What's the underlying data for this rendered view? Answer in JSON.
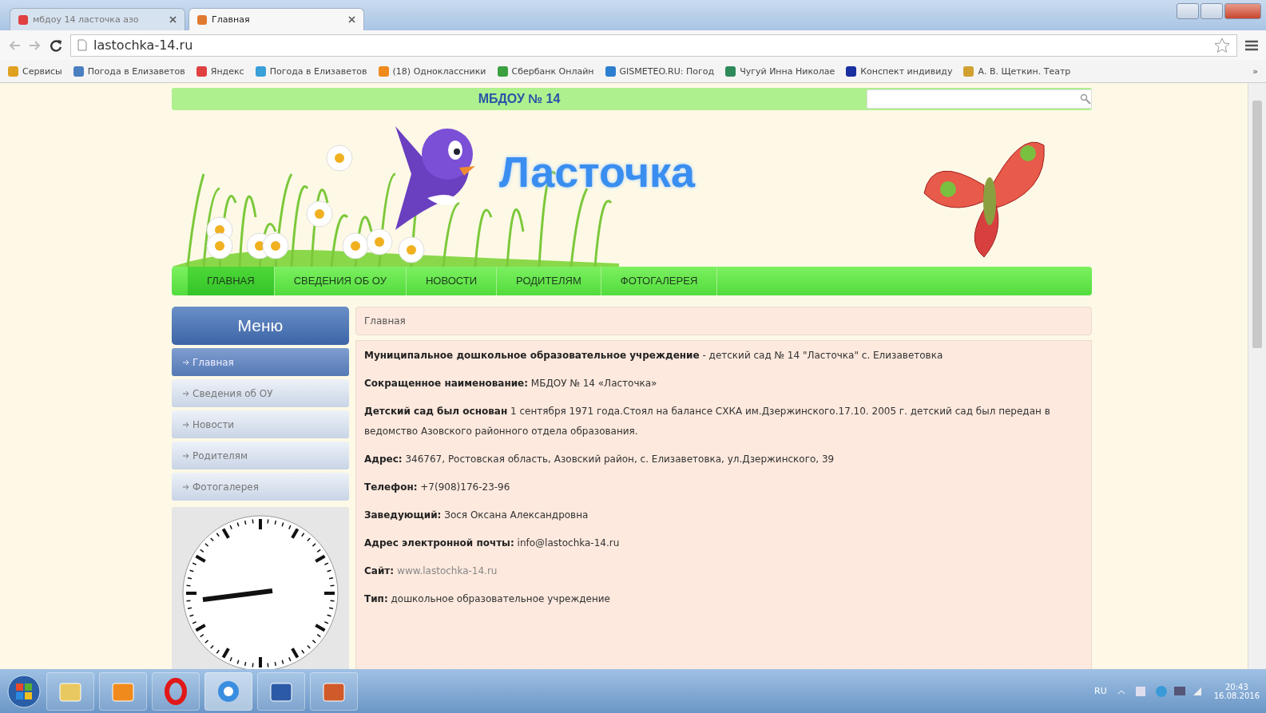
{
  "browser": {
    "tabs": [
      {
        "title": "мбдоу 14 ласточка азо",
        "selected": false
      },
      {
        "title": "Главная",
        "selected": true
      }
    ],
    "address": "lastochka-14.ru",
    "bookmarks": [
      {
        "label": "Сервисы",
        "color": "#e0a020"
      },
      {
        "label": "Погода в Елизаветов",
        "color": "#4a7fc0"
      },
      {
        "label": "Яндекс",
        "color": "#e04040"
      },
      {
        "label": "Погода в Елизаветов",
        "color": "#3aa0d8"
      },
      {
        "label": "(18) Одноклассники",
        "color": "#f08a1c"
      },
      {
        "label": "Сбербанк Онлайн",
        "color": "#3aa040"
      },
      {
        "label": "GISMETEO.RU: Погод",
        "color": "#2f7fd0"
      },
      {
        "label": "Чугуй Инна Николае",
        "color": "#2f8a5a"
      },
      {
        "label": "Конспект индивиду",
        "color": "#1a2fa0"
      },
      {
        "label": "А. В. Щеткин. Театр",
        "color": "#d0a030"
      }
    ],
    "more": "»"
  },
  "site": {
    "top_title": "МБДОУ № 14",
    "logo_title": "Ласточка",
    "nav": [
      {
        "label": "ГЛАВНАЯ",
        "selected": true
      },
      {
        "label": "СВЕДЕНИЯ ОБ ОУ",
        "selected": false
      },
      {
        "label": "НОВОСТИ",
        "selected": false
      },
      {
        "label": "РОДИТЕЛЯМ",
        "selected": false
      },
      {
        "label": "ФОТОГАЛЕРЕЯ",
        "selected": false
      }
    ],
    "menu": {
      "title": "Меню",
      "items": [
        {
          "label": "Главная",
          "selected": true
        },
        {
          "label": "Сведения об ОУ",
          "selected": false
        },
        {
          "label": "Новости",
          "selected": false
        },
        {
          "label": "Родителям",
          "selected": false
        },
        {
          "label": "Фотогалерея",
          "selected": false
        }
      ]
    },
    "breadcrumb": "Главная",
    "paragraphs": [
      {
        "kind": "text",
        "text": "**Муниципальное дошкольное образовательное учреждение** - детский сад № 14 \"Ласточка\" с. Елизаветовка"
      },
      {
        "kind": "text",
        "text": "**Сокращенное наименование:** МБДОУ № 14 «Ласточка»"
      },
      {
        "kind": "text",
        "text": "**Детский сад был основан** 1 сентября 1971 года.Стоял на балансе СХКА им.Дзержинского.17.10. 2005 г. детский сад был передан в ведомство Азовского районного отдела образования."
      },
      {
        "kind": "text",
        "text": "**Адрес:** 346767, Ростовская область, Азовский район, с. Елизаветовка, ул.Дзержинского, 39"
      },
      {
        "kind": "text",
        "text": "**Телефон:** +7(908)176-23-96"
      },
      {
        "kind": "text",
        "text": "**Заведующий:** Зося Оксана Александровна"
      },
      {
        "kind": "text",
        "text": "**Адрес электронной почты:** info@lastochka-14.ru"
      },
      {
        "kind": "link",
        "label": "Сайт:",
        "text": "www.lastochka-14.ru"
      },
      {
        "kind": "text",
        "text": "**Тип:** дошкольное образовательное учреждение"
      }
    ]
  },
  "taskbar": {
    "apps": [
      {
        "kind": "folder"
      },
      {
        "kind": "player"
      },
      {
        "kind": "opera"
      },
      {
        "kind": "chrome",
        "selected": true
      },
      {
        "kind": "word"
      },
      {
        "kind": "presentation"
      }
    ],
    "language": "RU",
    "time": "20:43",
    "date": "16.08.2016"
  }
}
